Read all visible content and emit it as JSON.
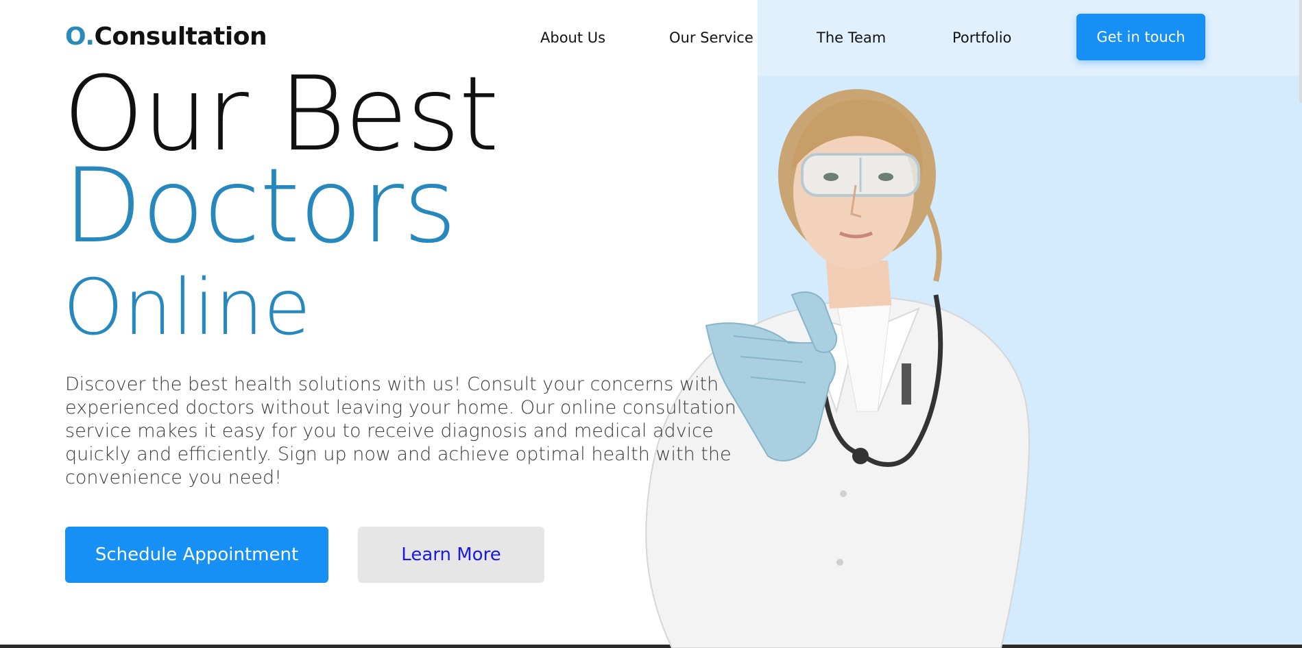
{
  "header": {
    "logo_mark": "O.",
    "logo_text": "Consultation",
    "nav": [
      {
        "label": "About Us"
      },
      {
        "label": "Our Service"
      },
      {
        "label": "The Team"
      },
      {
        "label": "Portfolio"
      }
    ],
    "cta_label": "Get in touch"
  },
  "hero": {
    "line1": "Our Best",
    "line2": "Doctors",
    "line3": "Online",
    "description": "Discover the best health solutions with us! Consult your concerns with experienced doctors without leaving your home. Our online consultation service makes it easy for you to receive diagnosis and medical advice quickly and efficiently. Sign up now and achieve optimal health with the convenience you need!",
    "primary_button": "Schedule Appointment",
    "secondary_button": "Learn More"
  },
  "colors": {
    "accent_blue": "#1690f5",
    "heading_blue": "#2688bd",
    "panel_blue": "#d4eafd",
    "secondary_button_bg": "#e6e6e6",
    "secondary_button_text": "#1a1ae0"
  },
  "image": {
    "subject": "doctor-photo"
  }
}
